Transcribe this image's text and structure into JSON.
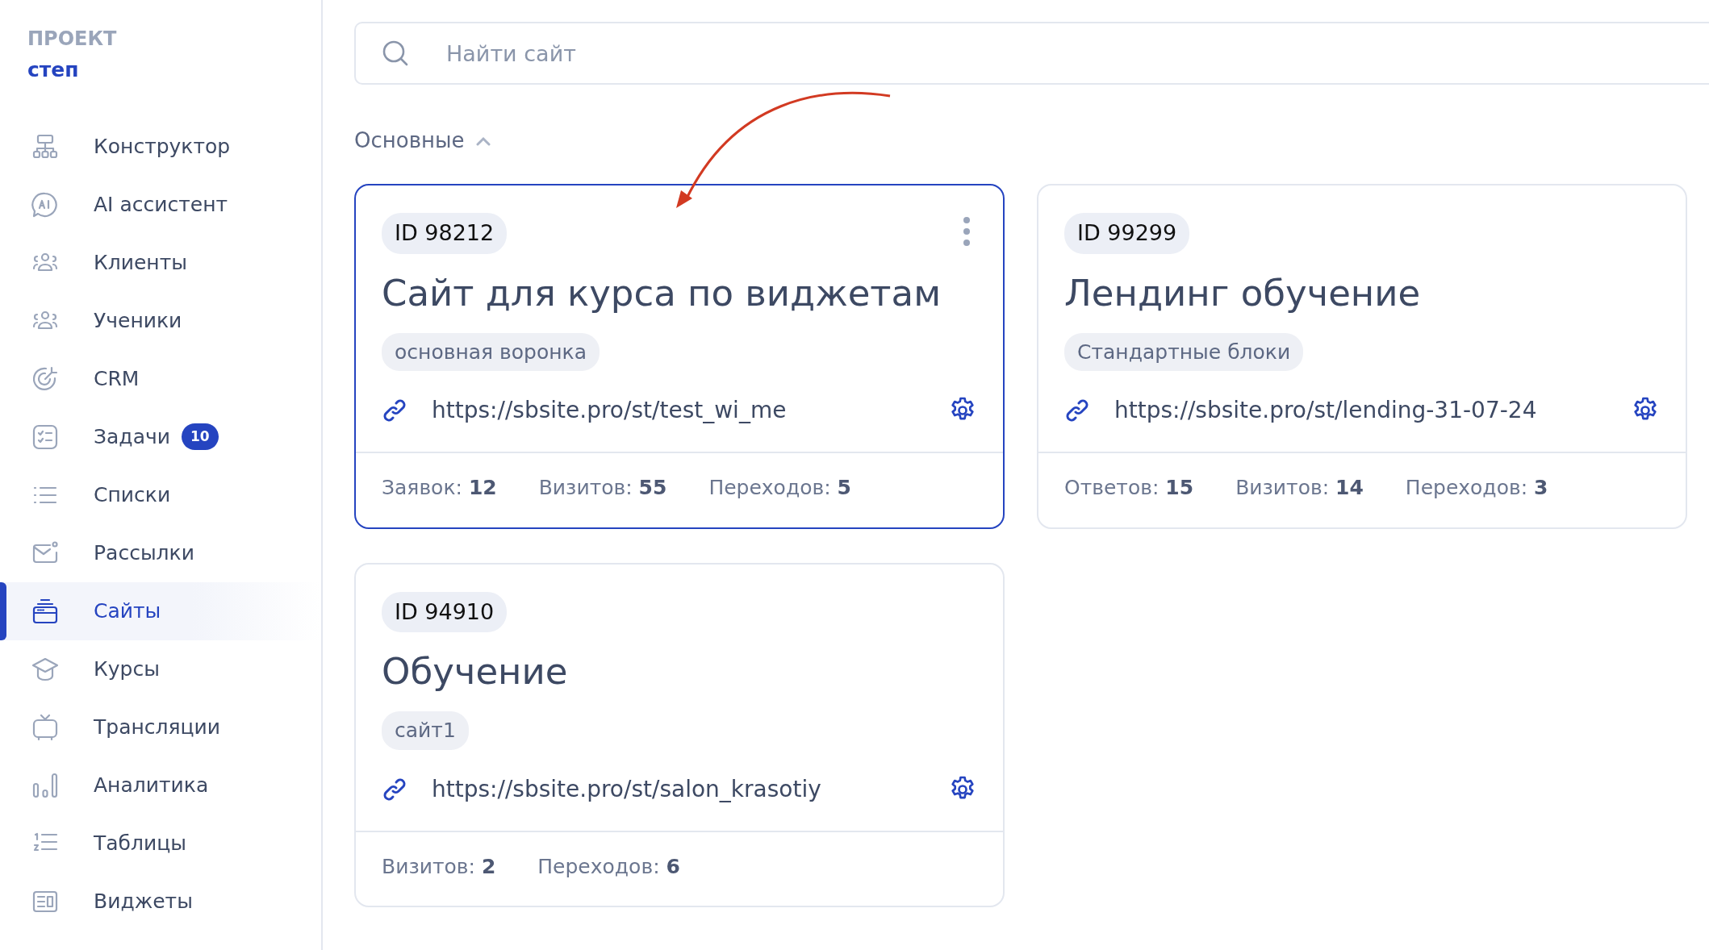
{
  "project": {
    "label": "ПРОЕКТ",
    "name": "степ"
  },
  "sidebar": {
    "items": [
      {
        "label": "Конструктор",
        "selected": false
      },
      {
        "label": "AI ассистент",
        "selected": false
      },
      {
        "label": "Клиенты",
        "selected": false
      },
      {
        "label": "Ученики",
        "selected": false
      },
      {
        "label": "CRM",
        "selected": false
      },
      {
        "label": "Задачи",
        "selected": false,
        "badge": "10"
      },
      {
        "label": "Списки",
        "selected": false
      },
      {
        "label": "Рассылки",
        "selected": false
      },
      {
        "label": "Сайты",
        "selected": true
      },
      {
        "label": "Курсы",
        "selected": false
      },
      {
        "label": "Трансляции",
        "selected": false
      },
      {
        "label": "Аналитика",
        "selected": false
      },
      {
        "label": "Таблицы",
        "selected": false
      },
      {
        "label": "Виджеты",
        "selected": false
      }
    ]
  },
  "search": {
    "placeholder": "Найти сайт"
  },
  "section": {
    "title": "Основные",
    "expanded": true
  },
  "sites": [
    {
      "id": "ID 98212",
      "title": "Сайт для курса по виджетам",
      "tag": "основная воронка",
      "url": "https://sbsite.pro/st/test_wi_me",
      "selected": true,
      "stats": [
        "Заявок: **12**",
        "Визитов: **55**",
        "Переходов: **5**"
      ]
    },
    {
      "id": "ID 99299",
      "title": "Лендинг обучение",
      "tag": "Стандартные блоки",
      "url": "https://sbsite.pro/st/lending-31-07-24",
      "selected": false,
      "stats": [
        "Ответов: **15**",
        "Визитов: **14**",
        "Переходов: **3**"
      ]
    },
    {
      "id": "ID 94910",
      "title": "Обучение",
      "tag": "сайт1",
      "url": "https://sbsite.pro/st/salon_krasotiy",
      "selected": false,
      "stats": [
        "Визитов: **2**",
        "Переходов: **6**"
      ]
    }
  ]
}
